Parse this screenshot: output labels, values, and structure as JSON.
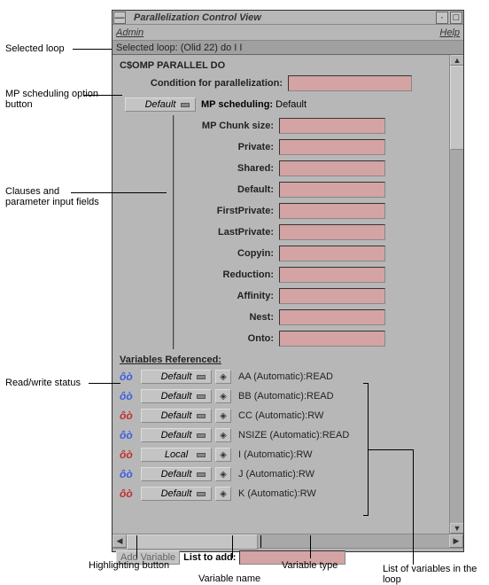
{
  "window": {
    "title": "Parallelization Control View",
    "menu_admin": "Admin",
    "menu_help": "Help",
    "selected_loop": "Selected loop: (Olid 22) do I I"
  },
  "main": {
    "heading": "C$OMP PARALLEL DO",
    "cond_label": "Condition for parallelization:",
    "mp_button": "Default",
    "mp_label": "MP scheduling:",
    "mp_value": "Default"
  },
  "clauses": [
    {
      "label": "MP Chunk size:"
    },
    {
      "label": "Private:"
    },
    {
      "label": "Shared:"
    },
    {
      "label": "Default:"
    },
    {
      "label": "FirstPrivate:"
    },
    {
      "label": "LastPrivate:"
    },
    {
      "label": "Copyin:"
    },
    {
      "label": "Reduction:"
    },
    {
      "label": "Affinity:"
    },
    {
      "label": "Nest:"
    },
    {
      "label": "Onto:"
    }
  ],
  "vars": {
    "heading": "Variables Referenced:",
    "rows": [
      {
        "rw": "read",
        "scope": "Default",
        "text": "AA (Automatic):READ"
      },
      {
        "rw": "read",
        "scope": "Default",
        "text": "BB (Automatic):READ"
      },
      {
        "rw": "rw",
        "scope": "Default",
        "text": "CC (Automatic):RW"
      },
      {
        "rw": "read",
        "scope": "Default",
        "text": "NSIZE (Automatic):READ"
      },
      {
        "rw": "rw",
        "scope": "Local",
        "text": "I (Automatic):RW"
      },
      {
        "rw": "read",
        "scope": "Default",
        "text": "J (Automatic):RW"
      },
      {
        "rw": "rw",
        "scope": "Default",
        "text": "K (Automatic):RW"
      }
    ]
  },
  "bottom": {
    "add_btn": "Add Variable",
    "list_label": "List to add:"
  },
  "callouts": {
    "selected_loop": "Selected loop",
    "mp_option": "MP scheduling option button",
    "clauses": "Clauses and parameter input fields",
    "rw_status": "Read/write status",
    "hl_button": "Highlighting button",
    "var_name": "Variable name",
    "var_type": "Variable type",
    "var_list": "List of variables in the loop"
  }
}
